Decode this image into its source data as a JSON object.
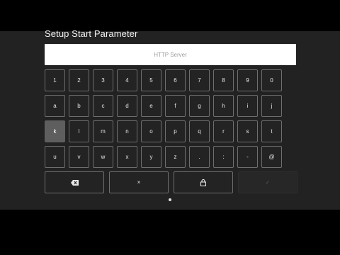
{
  "dialog": {
    "title": "Setup Start Parameter",
    "input": {
      "value": "",
      "placeholder": "HTTP Server"
    }
  },
  "keyboard": {
    "rows": [
      [
        "1",
        "2",
        "3",
        "4",
        "5",
        "6",
        "7",
        "8",
        "9",
        "0"
      ],
      [
        "a",
        "b",
        "c",
        "d",
        "e",
        "f",
        "g",
        "h",
        "i",
        "j"
      ],
      [
        "k",
        "l",
        "m",
        "n",
        "o",
        "p",
        "q",
        "r",
        "s",
        "t"
      ],
      [
        "u",
        "v",
        "w",
        "x",
        "y",
        "z",
        ".",
        ":",
        "-",
        "@"
      ]
    ],
    "focused_key": "k",
    "actions": {
      "backspace_icon": "backspace-icon",
      "clear_glyph": "×",
      "lock_icon": "lock-icon",
      "confirm_glyph": "✓",
      "confirm_enabled": false
    }
  },
  "pager": {
    "count": 1,
    "active": 1
  },
  "colors": {
    "panel": "#222222",
    "key_border": "#6e6e6e",
    "focused_key": "#5e5e5e",
    "input_bg": "#ffffff",
    "placeholder": "#9e9e9e"
  }
}
